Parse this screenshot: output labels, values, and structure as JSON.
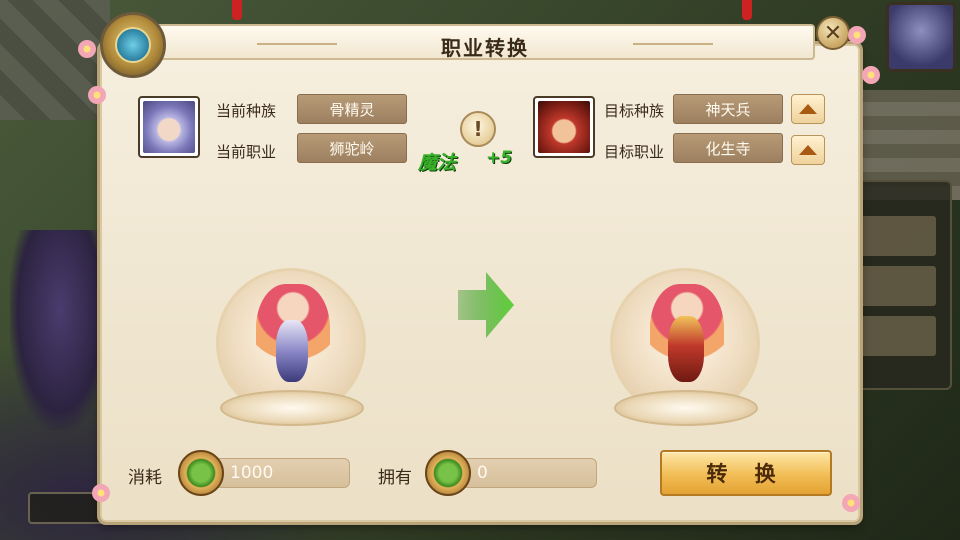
{
  "dialog": {
    "title": "职业转换",
    "close_glyph": "✕"
  },
  "current": {
    "race_label": "当前种族",
    "race_value": "骨精灵",
    "class_label": "当前职业",
    "class_value": "狮驼岭"
  },
  "target": {
    "race_label": "目标种族",
    "race_value": "神天兵",
    "class_label": "目标职业",
    "class_value": "化生寺"
  },
  "info": {
    "glyph": "!",
    "attribute_label": "魔法",
    "attribute_change": "+5"
  },
  "cost": {
    "label": "消耗",
    "value": "1000"
  },
  "owned": {
    "label": "拥有",
    "value": "0"
  },
  "convert_button": "转 换",
  "colors": {
    "accent_green": "#39b02a",
    "button_gold": "#f1bd55",
    "value_box_brown": "#9d8060"
  }
}
